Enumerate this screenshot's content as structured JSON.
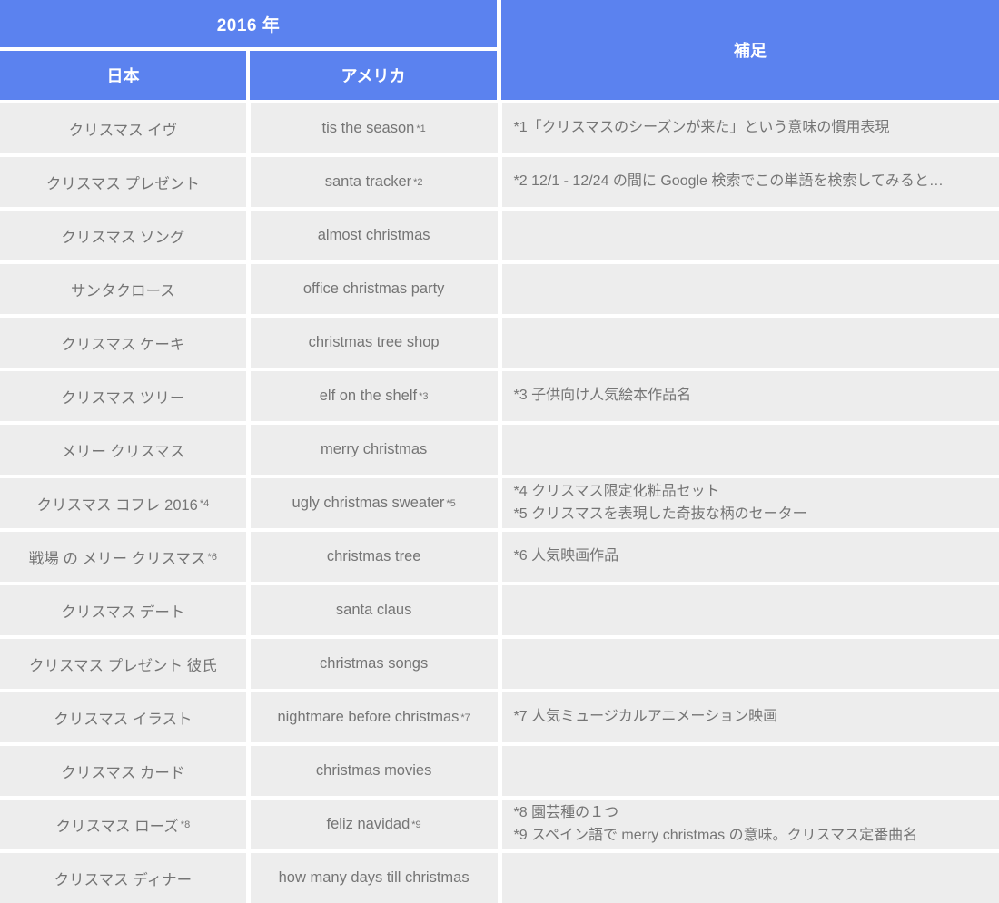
{
  "header": {
    "year_label": "2016 年",
    "col_japan": "日本",
    "col_america": "アメリカ",
    "col_notes": "補足"
  },
  "colors": {
    "header_blue": "#5b82ef",
    "cell_background": "#ededed",
    "cell_text": "#757575",
    "header_text": "#ffffff",
    "page_background": "#ffffff"
  },
  "rows": [
    {
      "japan": "クリスマス イヴ",
      "japan_ref": "",
      "america": "tis the season",
      "america_ref": "*1",
      "note": "*1「クリスマスのシーズンが来た」という意味の慣用表現"
    },
    {
      "japan": "クリスマス プレゼント",
      "japan_ref": "",
      "america": "santa tracker",
      "america_ref": "*2",
      "note": "*2 12/1 - 12/24 の間に Google 検索でこの単語を検索してみると…"
    },
    {
      "japan": "クリスマス ソング",
      "japan_ref": "",
      "america": "almost christmas",
      "america_ref": "",
      "note": ""
    },
    {
      "japan": "サンタクロース",
      "japan_ref": "",
      "america": "office christmas party",
      "america_ref": "",
      "note": ""
    },
    {
      "japan": "クリスマス ケーキ",
      "japan_ref": "",
      "america": "christmas tree shop",
      "america_ref": "",
      "note": ""
    },
    {
      "japan": "クリスマス ツリー",
      "japan_ref": "",
      "america": "elf on the shelf",
      "america_ref": "*3",
      "note": "*3 子供向け人気絵本作品名"
    },
    {
      "japan": "メリー クリスマス",
      "japan_ref": "",
      "america": "merry christmas",
      "america_ref": "",
      "note": ""
    },
    {
      "japan": "クリスマス コフレ 2016",
      "japan_ref": "*4",
      "america": "ugly christmas sweater",
      "america_ref": "*5",
      "note": "*4 クリスマス限定化粧品セット\n*5 クリスマスを表現した奇抜な柄のセーター"
    },
    {
      "japan": "戦場 の メリー クリスマス",
      "japan_ref": "*6",
      "america": "christmas tree",
      "america_ref": "",
      "note": "*6 人気映画作品"
    },
    {
      "japan": "クリスマス デート",
      "japan_ref": "",
      "america": "santa claus",
      "america_ref": "",
      "note": ""
    },
    {
      "japan": "クリスマス プレゼント 彼氏",
      "japan_ref": "",
      "america": "christmas songs",
      "america_ref": "",
      "note": ""
    },
    {
      "japan": "クリスマス イラスト",
      "japan_ref": "",
      "america": "nightmare before christmas",
      "america_ref": "*7",
      "note": "*7 人気ミュージカルアニメーション映画"
    },
    {
      "japan": "クリスマス カード",
      "japan_ref": "",
      "america": "christmas movies",
      "america_ref": "",
      "note": ""
    },
    {
      "japan": "クリスマス ローズ",
      "japan_ref": "*8",
      "america": "feliz navidad",
      "america_ref": "*9",
      "note": "*8 園芸種の１つ\n*9 スペイン語で merry christmas の意味。クリスマス定番曲名"
    },
    {
      "japan": "クリスマス ディナー",
      "japan_ref": "",
      "america": "how many days till christmas",
      "america_ref": "",
      "note": ""
    }
  ]
}
